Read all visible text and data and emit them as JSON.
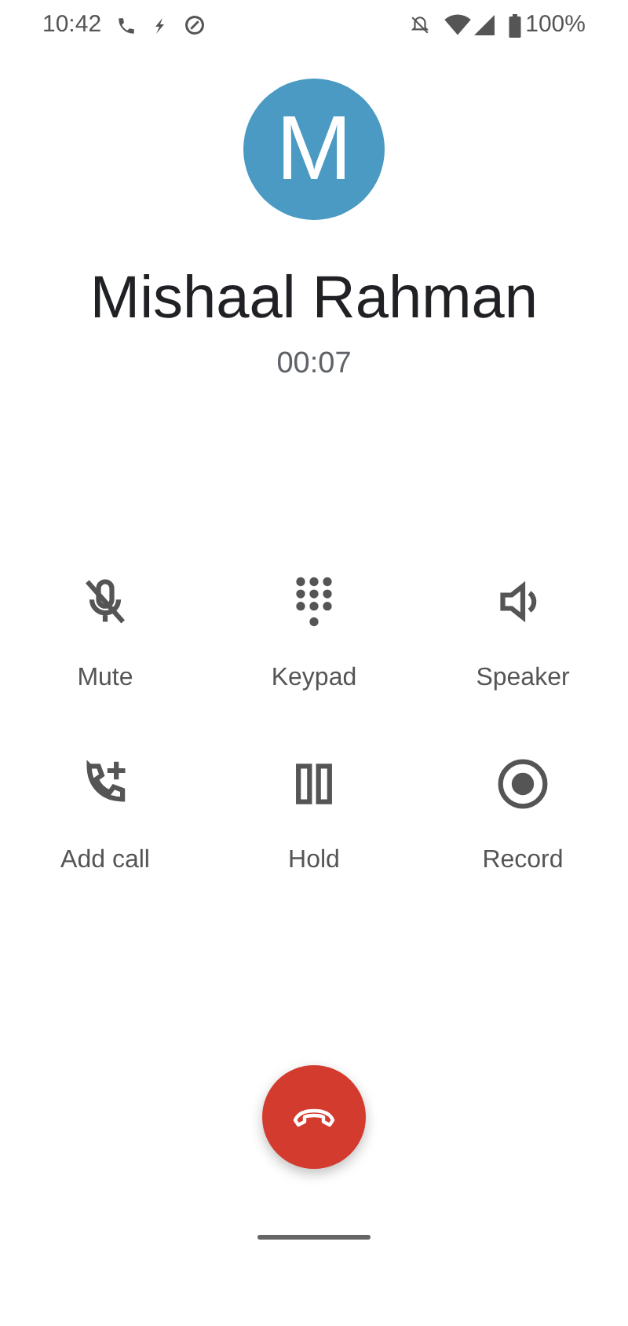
{
  "status_bar": {
    "time": "10:42",
    "battery": "100%"
  },
  "caller": {
    "avatar_letter": "M",
    "name": "Mishaal Rahman",
    "duration": "00:07"
  },
  "actions": [
    {
      "kind": "mute",
      "label": "Mute"
    },
    {
      "kind": "keypad",
      "label": "Keypad"
    },
    {
      "kind": "speaker",
      "label": "Speaker"
    },
    {
      "kind": "add_call",
      "label": "Add call"
    },
    {
      "kind": "hold",
      "label": "Hold"
    },
    {
      "kind": "record",
      "label": "Record"
    }
  ]
}
